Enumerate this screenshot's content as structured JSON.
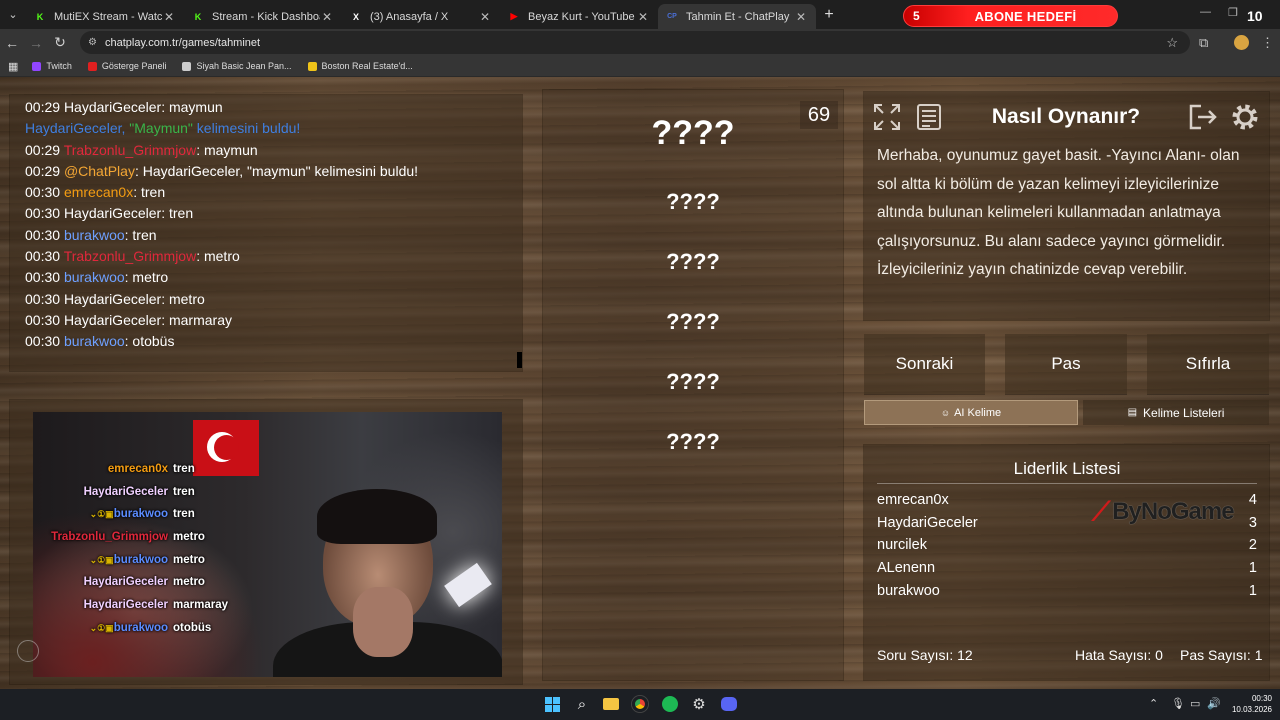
{
  "browser": {
    "tabs": [
      {
        "title": "MutiEX Stream - Watch Live on",
        "icon": "kick-icon",
        "color": "#53fc18",
        "active": false
      },
      {
        "title": "Stream - Kick Dashboard",
        "icon": "kick-icon",
        "color": "#53fc18",
        "active": false
      },
      {
        "title": "(3) Anasayfa / X",
        "icon": "x-icon",
        "color": "#ffffff",
        "active": false
      },
      {
        "title": "Beyaz Kurt - YouTube",
        "icon": "youtube-icon",
        "color": "#ff0000",
        "active": false
      },
      {
        "title": "Tahmin Et - ChatPlay",
        "icon": "chatplay-icon",
        "color": "#4a6fd6",
        "active": true
      }
    ],
    "url": "chatplay.com.tr/games/tahminet",
    "bookmarks": [
      {
        "label": "Twitch",
        "color": "#9146ff"
      },
      {
        "label": "Gösterge Paneli",
        "color": "#e02020"
      },
      {
        "label": "Siyah Basic Jean Pan...",
        "color": "#cccccc"
      },
      {
        "label": "Boston Real Estate'd...",
        "color": "#f0c419"
      }
    ]
  },
  "banner": {
    "left_number": "5",
    "title": "ABONE HEDEFİ",
    "right_number": "10"
  },
  "chat": {
    "lines": [
      {
        "time": "00:29",
        "user": "HaydariGeceler",
        "user_color": "#ffffff",
        "sep": ": ",
        "text": "maymun"
      },
      {
        "time": "",
        "user": "HaydariGeceler, ",
        "user_color": "#3f7fe0",
        "sep": "",
        "quoted": "\"Maymun\"",
        "quoted_color": "#39b54a",
        "text": " kelimesini buldu!",
        "text_color": "#3f7fe0"
      },
      {
        "time": "00:29",
        "user": "Trabzonlu_Grimmjow",
        "user_color": "#e0283c",
        "sep": ": ",
        "text": "maymun"
      },
      {
        "time": "00:29",
        "user": "@ChatPlay",
        "user_color": "#f3a634",
        "sep": ": ",
        "text": "HaydariGeceler, \"maymun\" kelimesini buldu!"
      },
      {
        "time": "00:30",
        "user": "emrecan0x",
        "user_color": "#f39c12",
        "sep": ": ",
        "text": "tren"
      },
      {
        "time": "00:30",
        "user": "HaydariGeceler",
        "user_color": "#ffffff",
        "sep": ": ",
        "text": "tren"
      },
      {
        "time": "00:30",
        "user": "burakwoo",
        "user_color": "#6ea0ff",
        "sep": ": ",
        "text": "tren"
      },
      {
        "time": "00:30",
        "user": "Trabzonlu_Grimmjow",
        "user_color": "#e0283c",
        "sep": ": ",
        "text": "metro"
      },
      {
        "time": "00:30",
        "user": "burakwoo",
        "user_color": "#6ea0ff",
        "sep": ": ",
        "text": "metro"
      },
      {
        "time": "00:30",
        "user": "HaydariGeceler",
        "user_color": "#ffffff",
        "sep": ": ",
        "text": "metro"
      },
      {
        "time": "00:30",
        "user": "HaydariGeceler",
        "user_color": "#ffffff",
        "sep": ": ",
        "text": "marmaray"
      },
      {
        "time": "00:30",
        "user": "burakwoo",
        "user_color": "#6ea0ff",
        "sep": ": ",
        "text": "otobüs"
      }
    ]
  },
  "webcam_chat": [
    {
      "user": "emrecan0x",
      "color": "#f39c12",
      "badges": "",
      "msg": "tren"
    },
    {
      "user": "HaydariGeceler",
      "color": "#f0d0ff",
      "badges": "",
      "msg": "tren"
    },
    {
      "user": "burakwoo",
      "color": "#5b8cff",
      "badges": "⌄①▣",
      "msg": "tren"
    },
    {
      "user": "Trabzonlu_Grimmjow",
      "color": "#e0283c",
      "badges": "",
      "msg": "metro"
    },
    {
      "user": "burakwoo",
      "color": "#5b8cff",
      "badges": "⌄①▣",
      "msg": "metro"
    },
    {
      "user": "HaydariGeceler",
      "color": "#f0d0ff",
      "badges": "",
      "msg": "metro"
    },
    {
      "user": "HaydariGeceler",
      "color": "#f0d0ff",
      "badges": "",
      "msg": "marmaray"
    },
    {
      "user": "burakwoo",
      "color": "#5b8cff",
      "badges": "⌄①▣",
      "msg": "otobüs"
    }
  ],
  "game": {
    "counter": "69",
    "main_word": "????",
    "hidden_words": [
      "????",
      "????",
      "????",
      "????",
      "????"
    ]
  },
  "info": {
    "title": "Nasıl Oynanır?",
    "text": "Merhaba, oyunumuz gayet basit. -Yayıncı Alanı- olan sol altta ki bölüm de yazan kelimeyi izleyicilerinize altında bulunan kelimeleri kullanmadan anlatmaya çalışıyorsunuz. Bu alanı sadece yayıncı görmelidir. İzleyicileriniz yayın chatinizde cevap verebilir."
  },
  "buttons": {
    "next": "Sonraki",
    "pass": "Pas",
    "reset": "Sıfırla"
  },
  "tabs": {
    "ai_word": "AI Kelime",
    "word_lists": "Kelime Listeleri"
  },
  "leaderboard": {
    "title": "Liderlik Listesi",
    "rows": [
      {
        "name": "emrecan0x",
        "score": "4"
      },
      {
        "name": "HaydariGeceler",
        "score": "3"
      },
      {
        "name": "nurcilek",
        "score": "2"
      },
      {
        "name": "ALenenn",
        "score": "1"
      },
      {
        "name": "burakwoo",
        "score": "1"
      }
    ],
    "sponsor": "ByNoGame"
  },
  "stats": {
    "questions": "Soru Sayısı: 12",
    "errors": "Hata Sayısı: 0",
    "passes": "Pas Sayısı: 1"
  },
  "taskbar": {
    "time": "00:30",
    "date": "10.03.2026"
  }
}
